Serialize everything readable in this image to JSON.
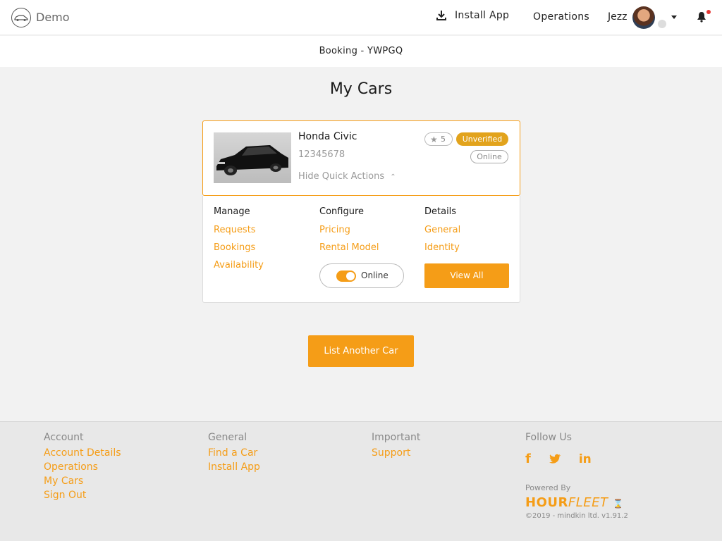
{
  "header": {
    "brand": "Demo",
    "install_label": "Install App",
    "operations_label": "Operations",
    "user_name": "Jezz"
  },
  "subheader": {
    "booking": "Booking - YWPGQ"
  },
  "page": {
    "title": "My Cars"
  },
  "car": {
    "name": "Honda Civic",
    "plate": "12345678",
    "quick_actions_label": "Hide Quick Actions",
    "rating": "5",
    "verification_badge": "Unverified",
    "status_badge": "Online"
  },
  "actions": {
    "manage": {
      "title": "Manage",
      "links": [
        "Requests",
        "Bookings",
        "Availability"
      ]
    },
    "configure": {
      "title": "Configure",
      "links": [
        "Pricing",
        "Rental Model"
      ],
      "toggle_label": "Online"
    },
    "details": {
      "title": "Details",
      "links": [
        "General",
        "Identity"
      ],
      "view_all": "View All"
    }
  },
  "list_another_label": "List Another Car",
  "footer": {
    "account": {
      "title": "Account",
      "links": [
        "Account Details",
        "Operations",
        "My Cars",
        "Sign Out"
      ]
    },
    "general": {
      "title": "General",
      "links": [
        "Find a Car",
        "Install App"
      ]
    },
    "important": {
      "title": "Important",
      "links": [
        "Support"
      ]
    },
    "follow": {
      "title": "Follow Us",
      "icons": [
        "facebook-icon",
        "twitter-icon",
        "linkedin-icon"
      ]
    },
    "powered_by": "Powered By",
    "logo_hour": "HOUR",
    "logo_fleet": "FLEET",
    "copyright": "©2019 - mindkin ltd. v1.91.2"
  },
  "colors": {
    "accent": "#f59d17",
    "badge": "#e2a31c"
  }
}
